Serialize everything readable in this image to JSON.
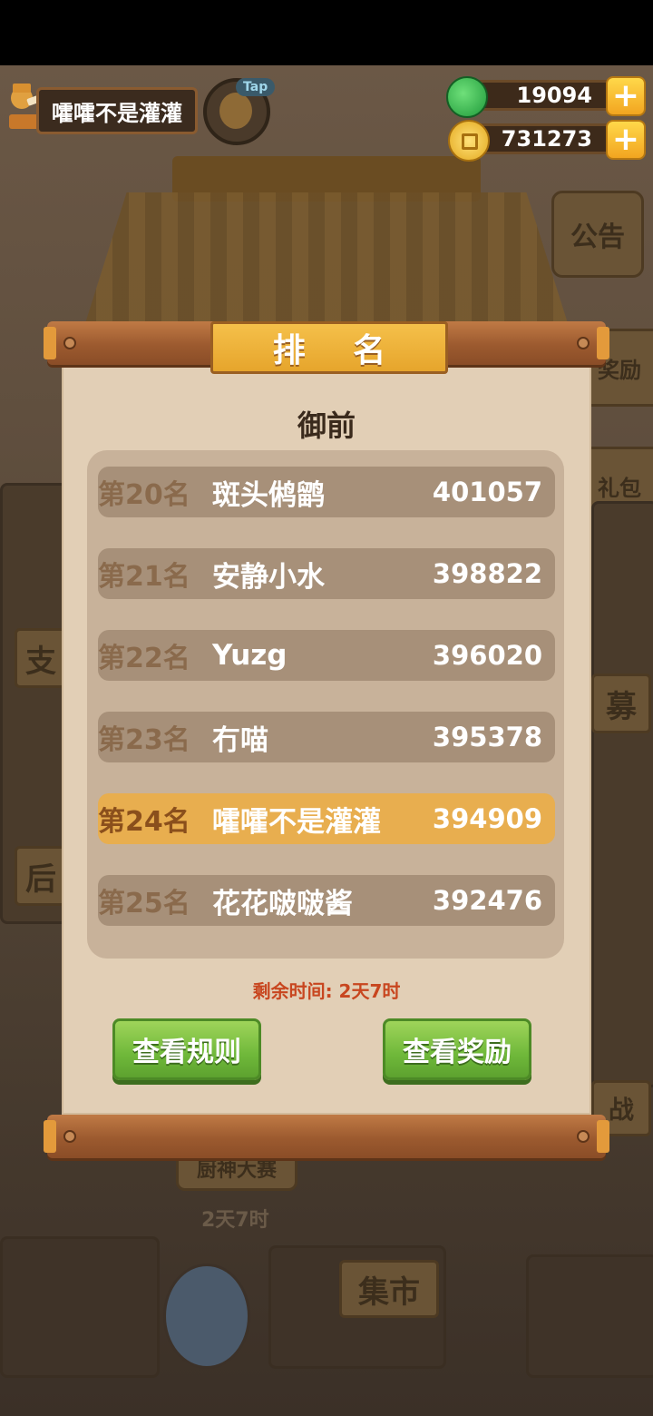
{
  "hud": {
    "player_name": "嚯嚯不是灌灌",
    "tap_label": "Tap",
    "jade_amount": "19094",
    "coin_amount": "731273"
  },
  "background": {
    "notice_label": "公告",
    "reward_label": "奖励",
    "gift_label": "礼包",
    "market_label": "集市",
    "chef_contest_label": "厨神大赛",
    "chef_contest_time": "2天7时",
    "side_left_1": "支",
    "side_left_2": "后",
    "side_right_1": "募",
    "side_right_2": "战"
  },
  "modal": {
    "title": "排 名",
    "league": "御前",
    "rankings": [
      {
        "rank": "第20名",
        "name": "斑头鸺鹠",
        "score": "401057",
        "is_me": false
      },
      {
        "rank": "第21名",
        "name": "安静小水",
        "score": "398822",
        "is_me": false
      },
      {
        "rank": "第22名",
        "name": "Yuzg",
        "score": "396020",
        "is_me": false
      },
      {
        "rank": "第23名",
        "name": "冇喵",
        "score": "395378",
        "is_me": false
      },
      {
        "rank": "第24名",
        "name": "嚯嚯不是灌灌",
        "score": "394909",
        "is_me": true
      },
      {
        "rank": "第25名",
        "name": "花花啵啵酱",
        "score": "392476",
        "is_me": false
      }
    ],
    "time_left": "剩余时间: 2天7时",
    "rules_button": "查看规则",
    "rewards_button": "查看奖励"
  },
  "colors": {
    "highlight_row": "#e8ae4f",
    "normal_row": "#a79079",
    "button_green": "#6fb83a",
    "time_text": "#c8461f"
  }
}
